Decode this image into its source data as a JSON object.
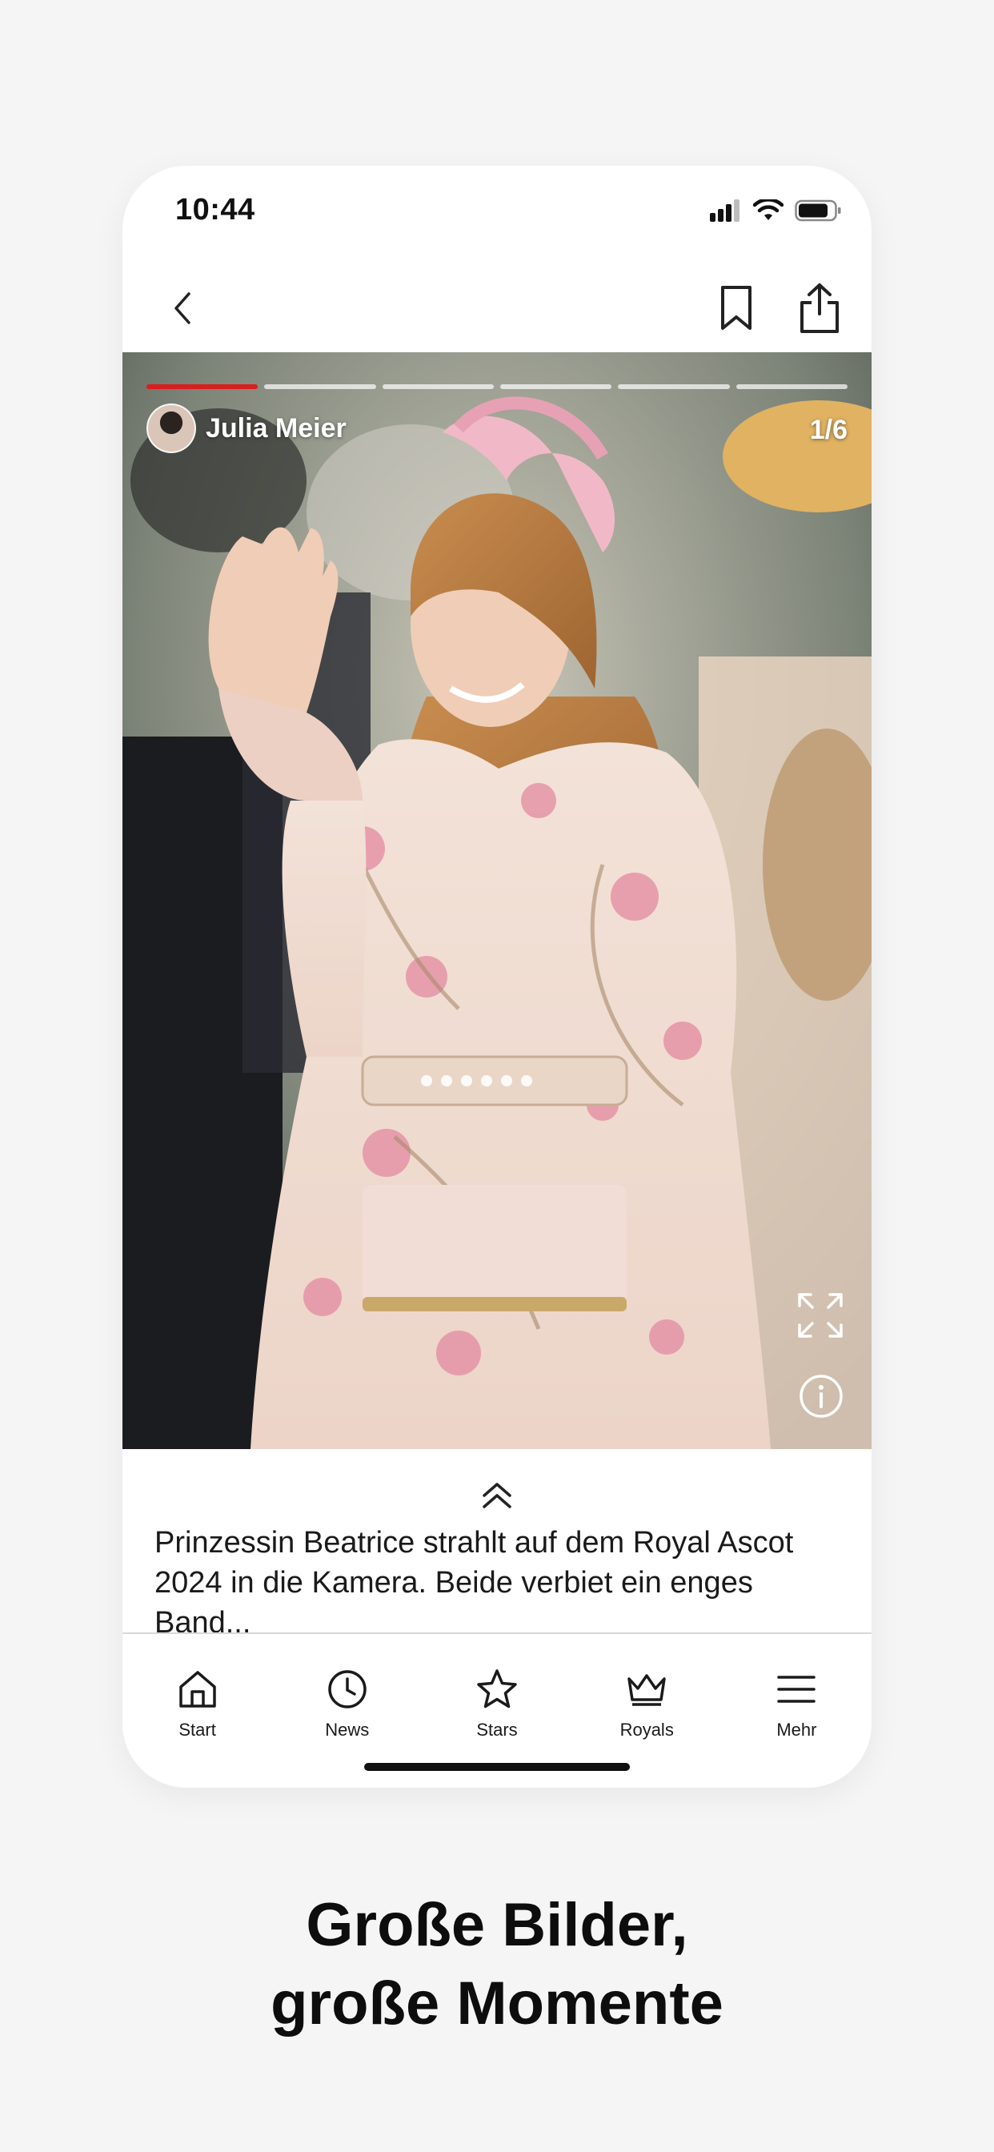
{
  "status_bar": {
    "time": "10:44"
  },
  "navigation": {
    "back_icon": "chevron-left-icon",
    "bookmark_icon": "bookmark-icon",
    "share_icon": "share-icon"
  },
  "gallery": {
    "author_name": "Julia Meier",
    "counter": "1/6",
    "progress": {
      "total": 6,
      "current": 1,
      "accent_color": "#d81e1e"
    },
    "image_alt_icon": "photo",
    "fullscreen_icon": "expand-icon",
    "info_icon": "info-icon"
  },
  "caption": {
    "expand_icon": "double-chevron-up-icon",
    "text_line1": "Prinzessin Beatrice strahlt auf dem Royal Ascot",
    "text_line2": "2024 in die Kamera. Beide verbiet ein enges Band..."
  },
  "tab_bar": {
    "items": [
      {
        "label": "Start",
        "icon": "home-icon"
      },
      {
        "label": "News",
        "icon": "clock-icon"
      },
      {
        "label": "Stars",
        "icon": "star-icon"
      },
      {
        "label": "Royals",
        "icon": "crown-icon"
      },
      {
        "label": "Mehr",
        "icon": "menu-icon"
      }
    ]
  },
  "promo": {
    "headline_line1": "Große Bilder,",
    "headline_line2": "große Momente"
  }
}
